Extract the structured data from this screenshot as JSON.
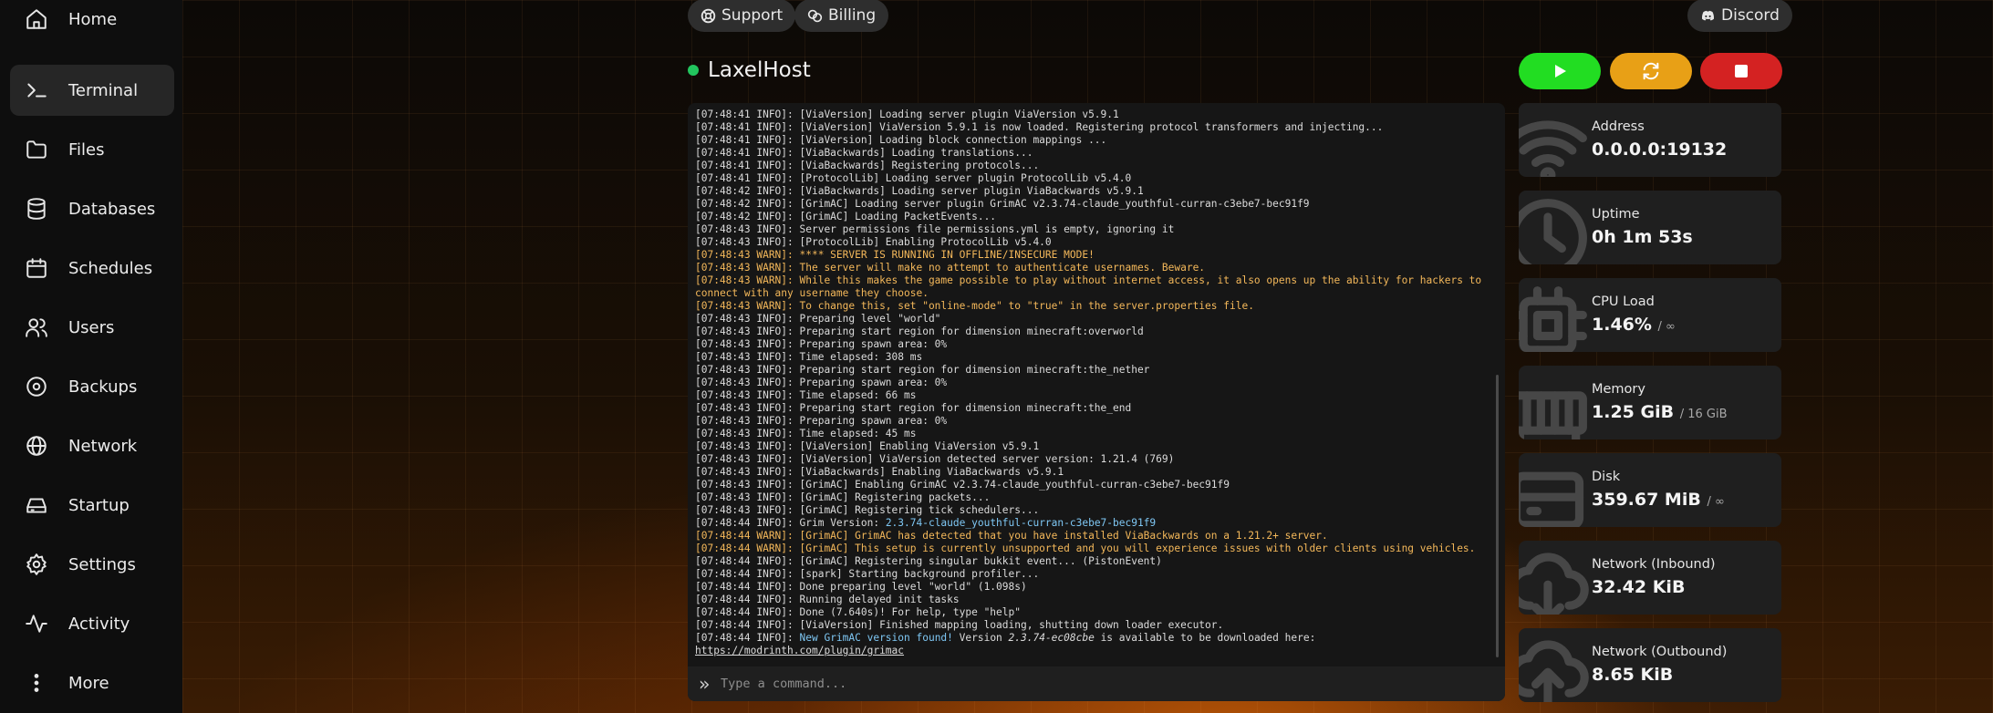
{
  "nav": {
    "items": [
      {
        "label": "Home",
        "icon": "home-icon"
      },
      {
        "label": "Terminal",
        "icon": "terminal-icon"
      },
      {
        "label": "Files",
        "icon": "folder-icon"
      },
      {
        "label": "Databases",
        "icon": "database-icon"
      },
      {
        "label": "Schedules",
        "icon": "calendar-icon"
      },
      {
        "label": "Users",
        "icon": "users-icon"
      },
      {
        "label": "Backups",
        "icon": "backup-icon"
      },
      {
        "label": "Network",
        "icon": "globe-icon"
      },
      {
        "label": "Startup",
        "icon": "startup-icon"
      },
      {
        "label": "Settings",
        "icon": "gear-icon"
      },
      {
        "label": "Activity",
        "icon": "activity-icon"
      },
      {
        "label": "More",
        "icon": "more-vertical-icon"
      }
    ],
    "active_index": 1
  },
  "topbar": {
    "support_label": "Support",
    "billing_label": "Billing",
    "discord_label": "Discord"
  },
  "server": {
    "name": "LaxelHost",
    "status_color": "#22c55e"
  },
  "power": {
    "start_color": "#22dd22",
    "restart_color": "#e8a016",
    "stop_color": "#d42222"
  },
  "console": {
    "lines": [
      {
        "t": "[07:48:41 INFO]: [ViaVersion] Loading server plugin ViaVersion v5.9.1"
      },
      {
        "t": "[07:48:41 INFO]: [ViaVersion] ViaVersion 5.9.1 is now loaded. Registering protocol transformers and injecting..."
      },
      {
        "t": "[07:48:41 INFO]: [ViaVersion] Loading block connection mappings ..."
      },
      {
        "t": "[07:48:41 INFO]: [ViaBackwards] Loading translations..."
      },
      {
        "t": "[07:48:41 INFO]: [ViaBackwards] Registering protocols..."
      },
      {
        "t": "[07:48:41 INFO]: [ProtocolLib] Loading server plugin ProtocolLib v5.4.0"
      },
      {
        "t": "[07:48:42 INFO]: [ViaBackwards] Loading server plugin ViaBackwards v5.9.1"
      },
      {
        "t": "[07:48:42 INFO]: [GrimAC] Loading server plugin GrimAC v2.3.74-claude_youthful-curran-c3ebe7-bec91f9"
      },
      {
        "t": "[07:48:42 INFO]: [GrimAC] Loading PacketEvents..."
      },
      {
        "t": "[07:48:43 INFO]: Server permissions file permissions.yml is empty, ignoring it"
      },
      {
        "t": "[07:48:43 INFO]: [ProtocolLib] Enabling ProtocolLib v5.4.0"
      },
      {
        "t": "[07:48:43 WARN]: **** SERVER IS RUNNING IN OFFLINE/INSECURE MODE!",
        "w": true
      },
      {
        "t": "[07:48:43 WARN]: The server will make no attempt to authenticate usernames. Beware.",
        "w": true
      },
      {
        "t": "[07:48:43 WARN]: While this makes the game possible to play without internet access, it also opens up the ability for hackers to connect with any username they choose.",
        "w": true
      },
      {
        "t": "[07:48:43 WARN]: To change this, set \"online-mode\" to \"true\" in the server.properties file.",
        "w": true
      },
      {
        "t": "[07:48:43 INFO]: Preparing level \"world\""
      },
      {
        "t": "[07:48:43 INFO]: Preparing start region for dimension minecraft:overworld"
      },
      {
        "t": "[07:48:43 INFO]: Preparing spawn area: 0%"
      },
      {
        "t": "[07:48:43 INFO]: Time elapsed: 308 ms"
      },
      {
        "t": "[07:48:43 INFO]: Preparing start region for dimension minecraft:the_nether"
      },
      {
        "t": "[07:48:43 INFO]: Preparing spawn area: 0%"
      },
      {
        "t": "[07:48:43 INFO]: Time elapsed: 66 ms"
      },
      {
        "t": "[07:48:43 INFO]: Preparing start region for dimension minecraft:the_end"
      },
      {
        "t": "[07:48:43 INFO]: Preparing spawn area: 0%"
      },
      {
        "t": "[07:48:43 INFO]: Time elapsed: 45 ms"
      },
      {
        "t": "[07:48:43 INFO]: [ViaVersion] Enabling ViaVersion v5.9.1"
      },
      {
        "t": "[07:48:43 INFO]: [ViaVersion] ViaVersion detected server version: 1.21.4 (769)"
      },
      {
        "t": "[07:48:43 INFO]: [ViaBackwards] Enabling ViaBackwards v5.9.1"
      },
      {
        "t": "[07:48:43 INFO]: [GrimAC] Enabling GrimAC v2.3.74-claude_youthful-curran-c3ebe7-bec91f9"
      },
      {
        "t": "[07:48:43 INFO]: [GrimAC] Registering packets..."
      },
      {
        "t": "[07:48:43 INFO]: [GrimAC] Registering tick schedulers..."
      },
      {
        "t": "[07:48:44 INFO]: ",
        "t2": "Grim Version: ",
        "hl": "2.3.74-claude_youthful-curran-c3ebe7-bec91f9"
      },
      {
        "t": "[07:48:44 WARN]: [GrimAC] GrimAC has detected that you have installed ViaBackwards on a 1.21.2+ server.",
        "w": true
      },
      {
        "t": "[07:48:44 WARN]: [GrimAC] This setup is currently unsupported and you will experience issues with older clients using vehicles.",
        "w": true
      },
      {
        "t": "[07:48:44 INFO]: [GrimAC] Registering singular bukkit event... (PistonEvent)"
      },
      {
        "t": "[07:48:44 INFO]: [spark] Starting background profiler..."
      },
      {
        "t": "[07:48:44 INFO]: Done preparing level \"world\" (1.098s)"
      },
      {
        "t": "[07:48:44 INFO]: Running delayed init tasks"
      },
      {
        "t": "[07:48:44 INFO]: Done (7.640s)! For help, type \"help\""
      },
      {
        "t": "[07:48:44 INFO]: [ViaVersion] Finished mapping loading, shutting down loader executor."
      },
      {
        "t": "[07:48:44 INFO]: ",
        "hl": "New GrimAC version found!",
        "t3": " Version ",
        "em": "2.3.74-ec08cbe",
        "t4": " is available to be downloaded here: ",
        "lnk": "https://modrinth.com/plugin/grimac"
      }
    ],
    "command_placeholder": "Type a command..."
  },
  "stats": [
    {
      "label": "Address",
      "value": "0.0.0.0:19132",
      "limit": "",
      "icon": "wifi-icon"
    },
    {
      "label": "Uptime",
      "value": "0h 1m 53s",
      "limit": "",
      "icon": "clock-icon"
    },
    {
      "label": "CPU Load",
      "value": "1.46%",
      "limit": "/ ∞",
      "icon": "cpu-icon"
    },
    {
      "label": "Memory",
      "value": "1.25 GiB",
      "limit": "/ 16 GiB",
      "icon": "memory-icon"
    },
    {
      "label": "Disk",
      "value": "359.67 MiB",
      "limit": "/ ∞",
      "icon": "disk-icon"
    },
    {
      "label": "Network (Inbound)",
      "value": "32.42 KiB",
      "limit": "",
      "icon": "cloud-download-icon"
    },
    {
      "label": "Network (Outbound)",
      "value": "8.65 KiB",
      "limit": "",
      "icon": "cloud-upload-icon"
    }
  ]
}
